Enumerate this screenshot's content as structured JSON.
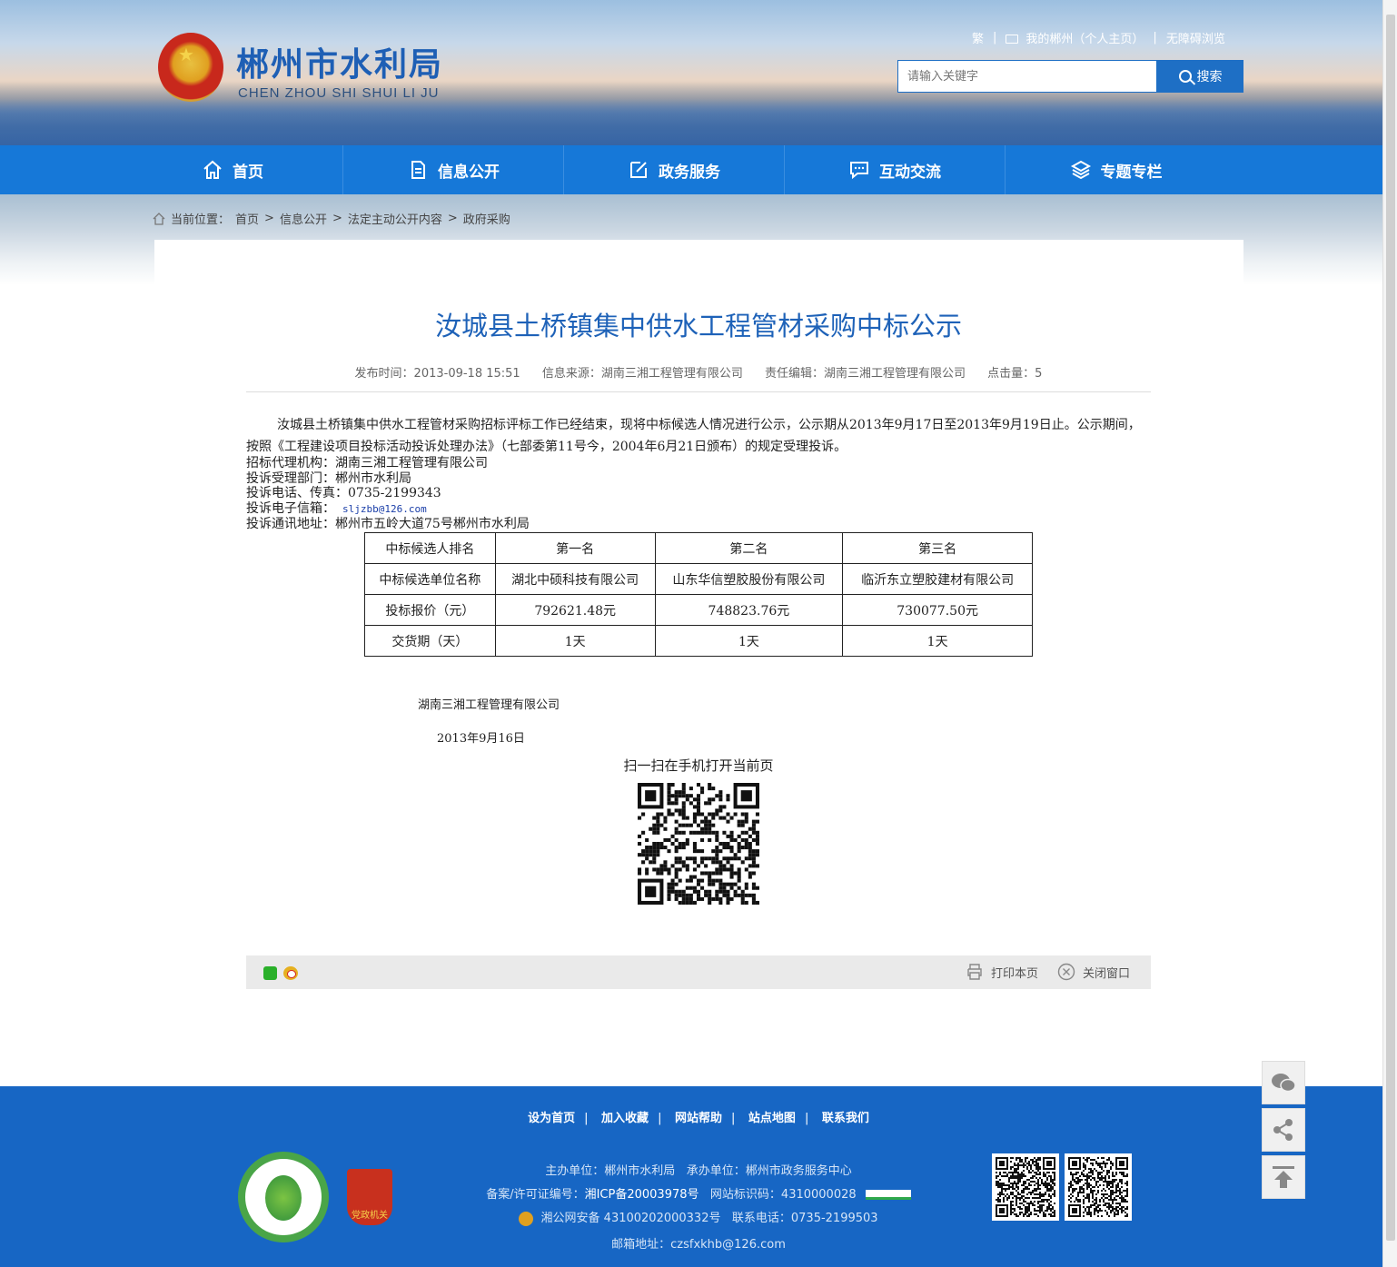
{
  "header": {
    "site_title": "郴州市水利局",
    "site_subtitle": "CHEN ZHOU SHI SHUI LI JU",
    "top_links": [
      "繁",
      "我的郴州（个人主页）",
      "无障碍浏览"
    ],
    "search": {
      "placeholder": "请输入关键字",
      "button_label": "搜索"
    }
  },
  "nav": {
    "items": [
      {
        "label": "首页",
        "icon": "home-icon"
      },
      {
        "label": "信息公开",
        "icon": "document-icon"
      },
      {
        "label": "政务服务",
        "icon": "edit-icon"
      },
      {
        "label": "互动交流",
        "icon": "chat-icon"
      },
      {
        "label": "专题专栏",
        "icon": "layers-icon"
      }
    ]
  },
  "breadcrumb": {
    "prefix": "当前位置：",
    "items": [
      "首页",
      "信息公开",
      "法定主动公开内容",
      "政府采购"
    ],
    "separator": ">"
  },
  "article": {
    "title": "汝城县土桥镇集中供水工程管材采购中标公示",
    "publish_time": "发布时间：2013-09-18 15:51",
    "source": "信息来源：湖南三湘工程管理有限公司",
    "editor": "责任编辑：湖南三湘工程管理有限公司",
    "hits": "点击量：5",
    "paragraph": "汝城县土桥镇集中供水工程管材采购招标评标工作已经结束，现将中标候选人情况进行公示，公示期从2013年9月17日至2013年9月19日止。公示期间，按照《工程建设项目投标活动投诉处理办法》（七部委第11号今，2004年6月21日颁布）的规定受理投诉。",
    "line_agency": "招标代理机构：湖南三湘工程管理有限公司",
    "line_dept": "投诉受理部门：郴州市水利局",
    "line_phone": "投诉电话、传真：0735-2199343",
    "line_email_label": "投诉电子信箱：",
    "line_email": "sljzbb@126.com",
    "line_address": "投诉通讯地址：郴州市五岭大道75号郴州市水利局",
    "table": {
      "rows": [
        [
          "中标候选人排名",
          "第一名",
          "第二名",
          "第三名"
        ],
        [
          "中标候选单位名称",
          "湖北中硕科技有限公司",
          "山东华信塑胶股份有限公司",
          "临沂东立塑胶建材有限公司"
        ],
        [
          "投标报价（元）",
          "792621.48元",
          "748823.76元",
          "730077.50元"
        ],
        [
          "交货期（天）",
          "1天",
          "1天",
          "1天"
        ]
      ]
    },
    "signature_company": "湖南三湘工程管理有限公司",
    "signature_date": "2013年9月16日",
    "qr_caption": "扫一扫在手机打开当前页"
  },
  "toolbar": {
    "share_icons": [
      "wechat-icon",
      "weibo-icon"
    ],
    "print_label": "打印本页",
    "close_label": "关闭窗口"
  },
  "footer": {
    "links": [
      "设为首页",
      "加入收藏",
      "网站帮助",
      "站点地图",
      "联系我们"
    ],
    "sponsor": "主办单位：郴州市水利局",
    "organizer": "承办单位：郴州市政务服务中心",
    "icp_label": "备案/许可证编号：",
    "icp": "湘ICP备20003978号",
    "site_id": "网站标识码：4310000028",
    "police": "湘公网安备 43100202000332号",
    "phone": "联系电话：0735-2199503",
    "email": "邮箱地址：czsfxkhb@126.com"
  },
  "colors": {
    "brand_blue": "#1678d8",
    "title_blue": "#1e62b8",
    "footer_blue": "#1766c4"
  }
}
